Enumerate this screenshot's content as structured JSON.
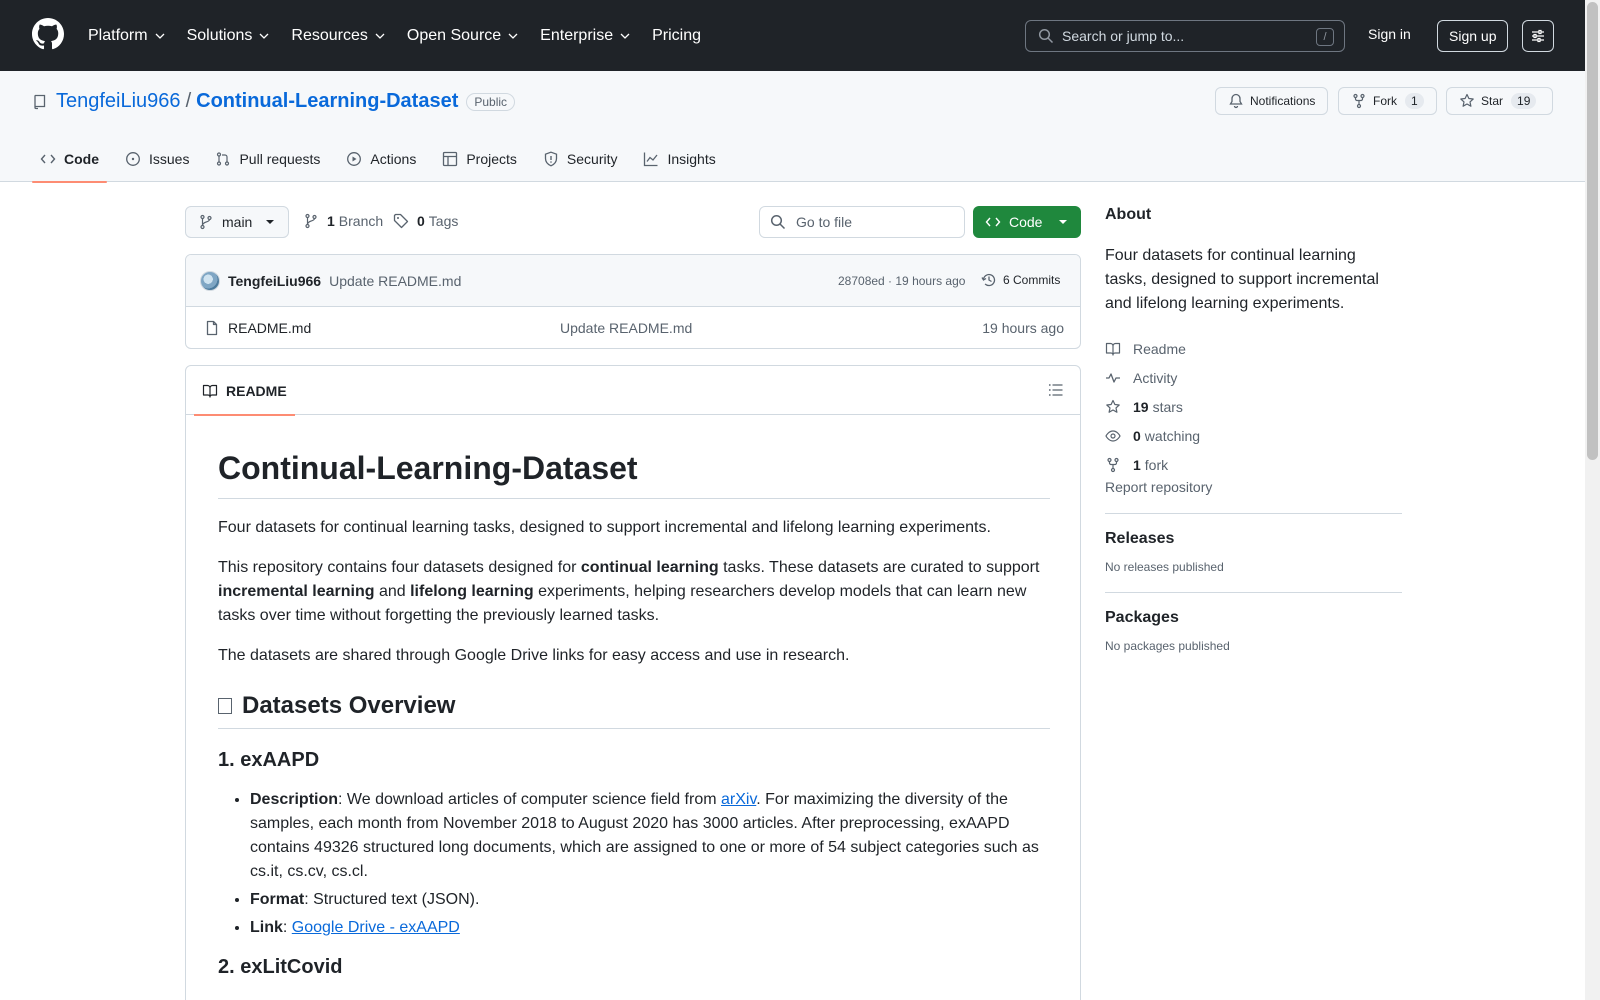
{
  "header": {
    "nav": [
      {
        "label": "Platform",
        "has_dropdown": true
      },
      {
        "label": "Solutions",
        "has_dropdown": true
      },
      {
        "label": "Resources",
        "has_dropdown": true
      },
      {
        "label": "Open Source",
        "has_dropdown": true
      },
      {
        "label": "Enterprise",
        "has_dropdown": true
      },
      {
        "label": "Pricing",
        "has_dropdown": false
      }
    ],
    "search_placeholder": "Search or jump to...",
    "search_shortcut": "/",
    "sign_in": "Sign in",
    "sign_up": "Sign up"
  },
  "repo": {
    "owner": "TengfeiLiu966",
    "separator": "/",
    "name": "Continual-Learning-Dataset",
    "visibility": "Public",
    "notifications_label": "Notifications",
    "fork_label": "Fork",
    "fork_count": "1",
    "star_label": "Star",
    "star_count": "19"
  },
  "tabs": [
    {
      "label": "Code",
      "icon": "code-icon",
      "active": true
    },
    {
      "label": "Issues",
      "icon": "issue-icon",
      "active": false
    },
    {
      "label": "Pull requests",
      "icon": "pull-request-icon",
      "active": false
    },
    {
      "label": "Actions",
      "icon": "play-icon",
      "active": false
    },
    {
      "label": "Projects",
      "icon": "table-icon",
      "active": false
    },
    {
      "label": "Security",
      "icon": "shield-icon",
      "active": false
    },
    {
      "label": "Insights",
      "icon": "graph-icon",
      "active": false
    }
  ],
  "toolbar": {
    "branch": "main",
    "branch_count": "1",
    "branch_label": "Branch",
    "tag_count": "0",
    "tag_label": "Tags",
    "goto_placeholder": "Go to file",
    "code_button": "Code"
  },
  "commit": {
    "user": "TengfeiLiu966",
    "message": "Update README.md",
    "hash_time": "28708ed · 19 hours ago",
    "commits_label": "6 Commits"
  },
  "files": [
    {
      "name": "README.md",
      "message": "Update README.md",
      "date": "19 hours ago"
    }
  ],
  "readme": {
    "tab_label": "README",
    "title": "Continual-Learning-Dataset",
    "intro": "Four datasets for continual learning tasks, designed to support incremental and lifelong learning experiments.",
    "p2_a": "This repository contains four datasets designed for ",
    "p2_b": "continual learning",
    "p2_c": " tasks. These datasets are curated to support ",
    "p2_d": "incremental learning",
    "p2_e": " and ",
    "p2_f": "lifelong learning",
    "p2_g": " experiments, helping researchers develop models that can learn new tasks over time without forgetting the previously learned tasks.",
    "p3": "The datasets are shared through Google Drive links for easy access and use in research.",
    "overview_heading": "Datasets Overview",
    "ds1_heading": "1. exAAPD",
    "ds1_desc_label": "Description",
    "ds1_desc_a": ": We download articles of computer science field from ",
    "ds1_desc_link": "arXiv",
    "ds1_desc_b": ". For maximizing the diversity of the samples, each month from November 2018 to August 2020 has 3000 articles. After preprocessing, exAAPD contains 49326 structured long documents, which are assigned to one or more of 54 subject categories such as cs.it, cs.cv, cs.cl.",
    "ds1_format_label": "Format",
    "ds1_format": ": Structured text (JSON).",
    "ds1_link_label": "Link",
    "ds1_link_sep": ": ",
    "ds1_link": "Google Drive - exAAPD",
    "ds2_heading": "2. exLitCovid"
  },
  "about": {
    "heading": "About",
    "description": "Four datasets for continual learning tasks, designed to support incremental and lifelong learning experiments.",
    "readme": "Readme",
    "activity": "Activity",
    "stars_count": "19",
    "stars_label": "stars",
    "watching_count": "0",
    "watching_label": "watching",
    "fork_count": "1",
    "fork_label": "fork",
    "report": "Report repository"
  },
  "releases": {
    "heading": "Releases",
    "empty": "No releases published"
  },
  "packages": {
    "heading": "Packages",
    "empty": "No packages published"
  },
  "colors": {
    "header_bg": "#1f2328",
    "link": "#0969da",
    "accent_tab": "#fd8c73",
    "code_button": "#1f883d"
  }
}
